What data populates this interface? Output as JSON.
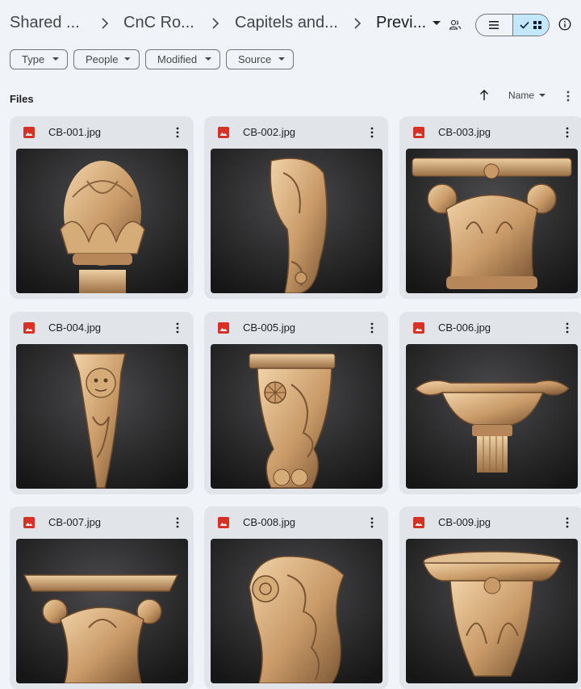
{
  "breadcrumb": {
    "items": [
      "Shared ...",
      "CnC Ro...",
      "Capitels and..."
    ],
    "current": "Previ..."
  },
  "header_icons": [
    "manage-people-icon",
    "list-view-icon",
    "checkmark-icon",
    "grid-view-icon",
    "info-icon"
  ],
  "filters": [
    "Type",
    "People",
    "Modified",
    "Source"
  ],
  "files_section": {
    "label": "Files",
    "sort_label": "Name"
  },
  "files": [
    {
      "name": "CB-001.jpg",
      "icon": "image-file-icon"
    },
    {
      "name": "CB-002.jpg",
      "icon": "image-file-icon"
    },
    {
      "name": "CB-003.jpg",
      "icon": "image-file-icon"
    },
    {
      "name": "CB-004.jpg",
      "icon": "image-file-icon"
    },
    {
      "name": "CB-005.jpg",
      "icon": "image-file-icon"
    },
    {
      "name": "CB-006.jpg",
      "icon": "image-file-icon"
    },
    {
      "name": "CB-007.jpg",
      "icon": "image-file-icon"
    },
    {
      "name": "CB-008.jpg",
      "icon": "image-file-icon"
    },
    {
      "name": "CB-009.jpg",
      "icon": "image-file-icon"
    }
  ],
  "colors": {
    "background": "#f0f3f8",
    "card": "#e1e5ea",
    "accent_toggle": "#c2e7ff",
    "image_icon": "#d93025",
    "wood": "#c9a27a"
  }
}
